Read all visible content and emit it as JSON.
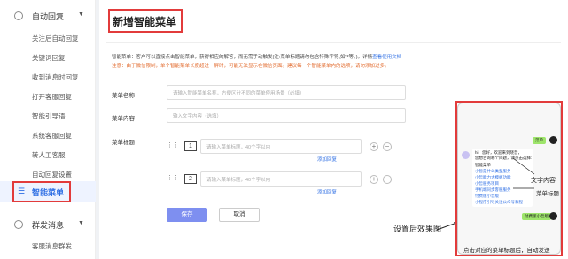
{
  "sidebar": {
    "group1": "自动回复",
    "items": [
      "关注后自动回复",
      "关键词回复",
      "收到消息时回复",
      "打开客服回复",
      "智能引导语",
      "系统客服回复",
      "转人工客服",
      "自动回复设置"
    ],
    "active": "智能菜单",
    "group2": "群发消息",
    "group2_items": [
      "客服消息群发"
    ]
  },
  "page": {
    "title": "新增智能菜单",
    "note1": "智能菜单：客户可以直接点击智能菜单，获得相应的解答，而无需手动触发(注:菜单标题请勿包含特殊字符,如\"*等。)。详情",
    "note1_link": "查看使用文档",
    "note2": "注意：由于微信限制，单个智能菜单长度超过一屏时，可能无法显示在微信页面。建议每一个智能菜单内的选项，请勿添加过多。"
  },
  "form": {
    "name_label": "菜单名称",
    "name_placeholder": "请输入智能菜单名称，方便区分不同的菜单使用场景（必填）",
    "content_label": "菜单内容",
    "content_placeholder": "输入文字内容（选填）",
    "title_label": "菜单标题",
    "rows": [
      {
        "num": "1",
        "placeholder": "请输入菜单标题，40个字以内",
        "add_reply": "添加回复"
      },
      {
        "num": "2",
        "placeholder": "请输入菜单标题，40个字以内",
        "add_reply": "添加回复"
      }
    ],
    "save": "保存",
    "cancel": "取消"
  },
  "demo": {
    "caption": "设置后效果图",
    "user_msg": "菜单",
    "bot_lines": [
      "hi，您好，欢迎来到晓哲，",
      "您想咨询哪个问题，请点击选择:",
      "智能菜单",
      "小哲是什么类型服务",
      "小哲能力大模板功能",
      "小哲服务项目",
      "手机端同步客服服务",
      "付费版小哲版",
      "小程序引导关注公众号教程"
    ],
    "user_reply": "付费版小哲版",
    "ann_content": "文字内容",
    "ann_title": "菜单标题",
    "bottom_note": "点击对应的菜单标题后，自动发送"
  },
  "colors": {
    "accent": "#2f6fe4",
    "highlight": "#e23b3b",
    "warn": "#e26a2c"
  }
}
